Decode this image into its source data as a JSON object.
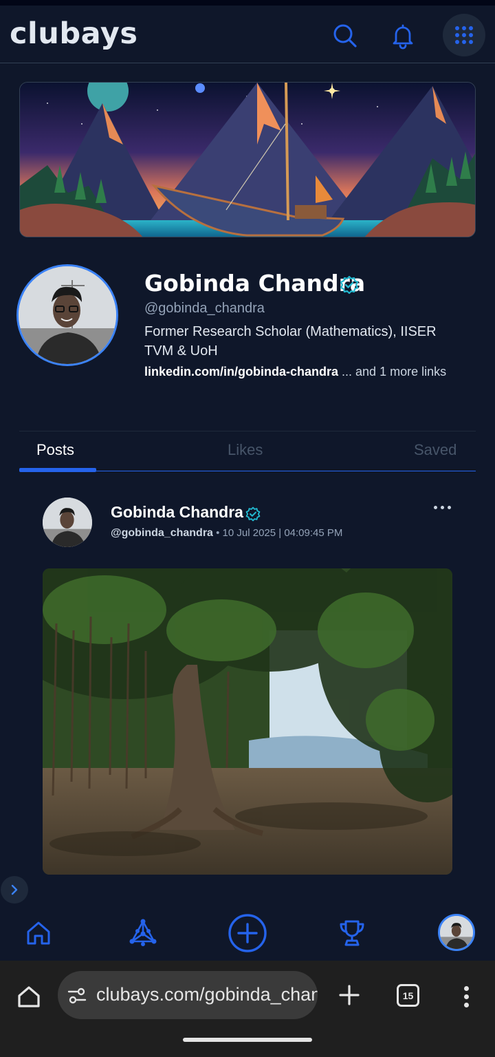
{
  "app": {
    "logo_text": "clubays"
  },
  "header": {
    "icons": [
      "search-icon",
      "bell-icon",
      "apps-grid-icon"
    ],
    "accent_color": "#2563eb"
  },
  "profile": {
    "name": "Gobinda Chandra",
    "handle": "@gobinda_chandra",
    "bio": "Former Research Scholar (Mathematics), IISER TVM & UoH",
    "primary_link": "linkedin.com/in/gobinda-chandra",
    "more_links": " ... and 1 more links",
    "verified": true
  },
  "tabs": [
    {
      "label": "Posts",
      "active": true
    },
    {
      "label": "Likes",
      "active": false
    },
    {
      "label": "Saved",
      "active": false
    }
  ],
  "post": {
    "author": "Gobinda Chandra",
    "handle": "@gobinda_chandra",
    "timestamp": " • 10 Jul 2025 | 04:09:45 PM",
    "verified": true
  },
  "bottom_nav": {
    "items": [
      "home-icon",
      "network-graph-icon",
      "add-circle-icon",
      "trophy-icon",
      "profile-avatar"
    ]
  },
  "browser": {
    "url": "clubays.com/gobinda_chandra",
    "tab_count": "15"
  }
}
